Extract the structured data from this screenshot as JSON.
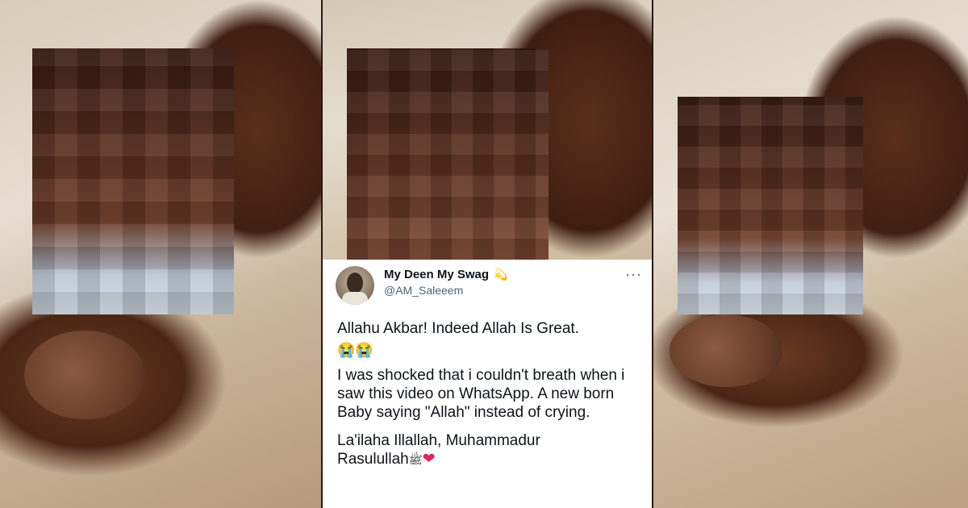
{
  "tweet": {
    "display_name": "My Deen My Swag",
    "name_badge": "💫",
    "handle": "@AM_Saleeem",
    "more_menu": "···",
    "line1": "Allahu Akbar! Indeed Allah Is Great.",
    "emojis": "😭😭",
    "para2": "I was shocked that i couldn't breath when i saw this video on WhatsApp. A new born Baby saying \"Allah\" instead of crying.",
    "para3_a": "La'ilaha Illallah, Muhammadur",
    "para3_b": "Rasulullah",
    "para3_symbol": "ﷺ",
    "para3_heart": "❤"
  },
  "colors": {
    "name": "#0f1419",
    "handle": "#536471",
    "heart": "#e0245e"
  }
}
